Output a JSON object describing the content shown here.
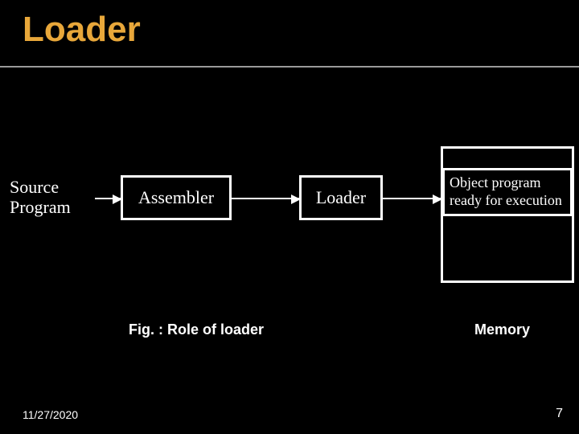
{
  "title": "Loader",
  "diagram": {
    "source_label": "Source\nProgram",
    "assembler_label": "Assembler",
    "loader_label": "Loader",
    "memory_content": "Object program ready for execution",
    "memory_label": "Memory",
    "caption": "Fig. : Role of loader"
  },
  "footer": {
    "date": "11/27/2020",
    "page": "7"
  },
  "chart_data": {
    "type": "diagram",
    "nodes": [
      {
        "id": "source",
        "label": "Source Program",
        "kind": "text"
      },
      {
        "id": "assembler",
        "label": "Assembler",
        "kind": "box"
      },
      {
        "id": "loader",
        "label": "Loader",
        "kind": "box"
      },
      {
        "id": "memory",
        "label": "Memory",
        "kind": "container",
        "content": "Object program ready for execution"
      }
    ],
    "edges": [
      {
        "from": "source",
        "to": "assembler"
      },
      {
        "from": "assembler",
        "to": "loader"
      },
      {
        "from": "loader",
        "to": "memory"
      }
    ],
    "title": "Role of loader"
  }
}
